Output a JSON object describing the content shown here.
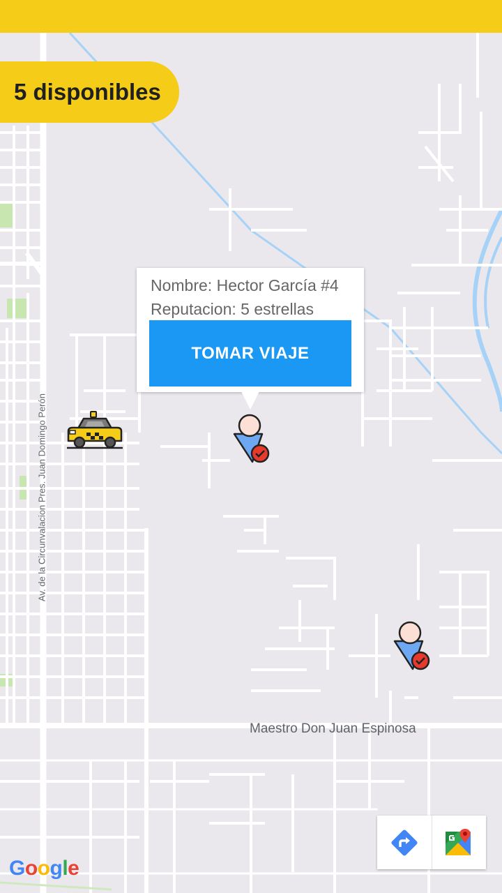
{
  "header": {
    "available_label": "5 disponibles"
  },
  "info_window": {
    "name_line": "Nombre: Hector García #4",
    "reputation_line": "Reputacion: 5 estrellas",
    "action_label": "TOMAR VIAJE"
  },
  "map": {
    "street_labels": {
      "vertical": "Av. de la Circunvalacion Pres. Juan Domingo Perón",
      "horizontal": "Maestro Don Juan Espinosa"
    },
    "google_logo": [
      "G",
      "o",
      "o",
      "g",
      "l",
      "e"
    ]
  },
  "colors": {
    "accent": "#f5cc17",
    "button": "#1a98f4",
    "map_bg": "#eae8ec",
    "water": "#a7d2f7",
    "park": "#c8e6b0"
  },
  "markers": {
    "taxi_icon": "taxi-icon",
    "passenger_icon": "passenger-verified-icon"
  }
}
